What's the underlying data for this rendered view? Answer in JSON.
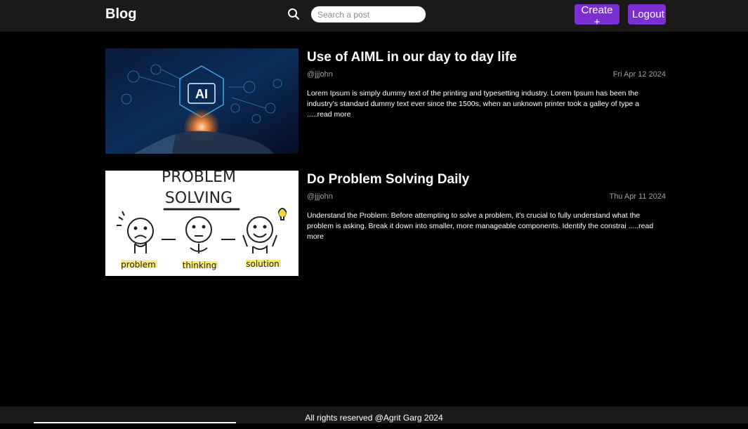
{
  "header": {
    "brand": "Blog",
    "search_placeholder": "Search a post",
    "search_value": "",
    "create_label": "Create +",
    "logout_label": "Logout",
    "accent_color": "#7b2fd0"
  },
  "posts": [
    {
      "title": "Use of AIML in our day to day life",
      "author": "@jjjohn",
      "date": "Fri Apr 12 2024",
      "excerpt": "Lorem Ipsum is simply dummy text of the printing and typesetting industry. Lorem Ipsum has been the industry's standard dummy text ever since the 1500s, when an unknown printer took a galley of type a ",
      "read_more": ".....read more",
      "image": {
        "icon": "ai-hand-image",
        "label": "AI"
      }
    },
    {
      "title": "Do Problem Solving Daily",
      "author": "@jjjohn",
      "date": "Thu Apr 11 2024",
      "excerpt": "Understand the Problem: Before attempting to solve a problem, it's crucial to fully understand what the problem is asking. Break it down into smaller, more manageable components. Identify the constrai ",
      "read_more": ".....read more",
      "image": {
        "icon": "problem-solving-image",
        "heading_line1": "PROBLEM",
        "heading_line2": "SOLVING",
        "labels": [
          "problem",
          "thinking",
          "solution"
        ]
      }
    }
  ],
  "footer": {
    "text": "All rights reserved @Agrit Garg 2024"
  }
}
